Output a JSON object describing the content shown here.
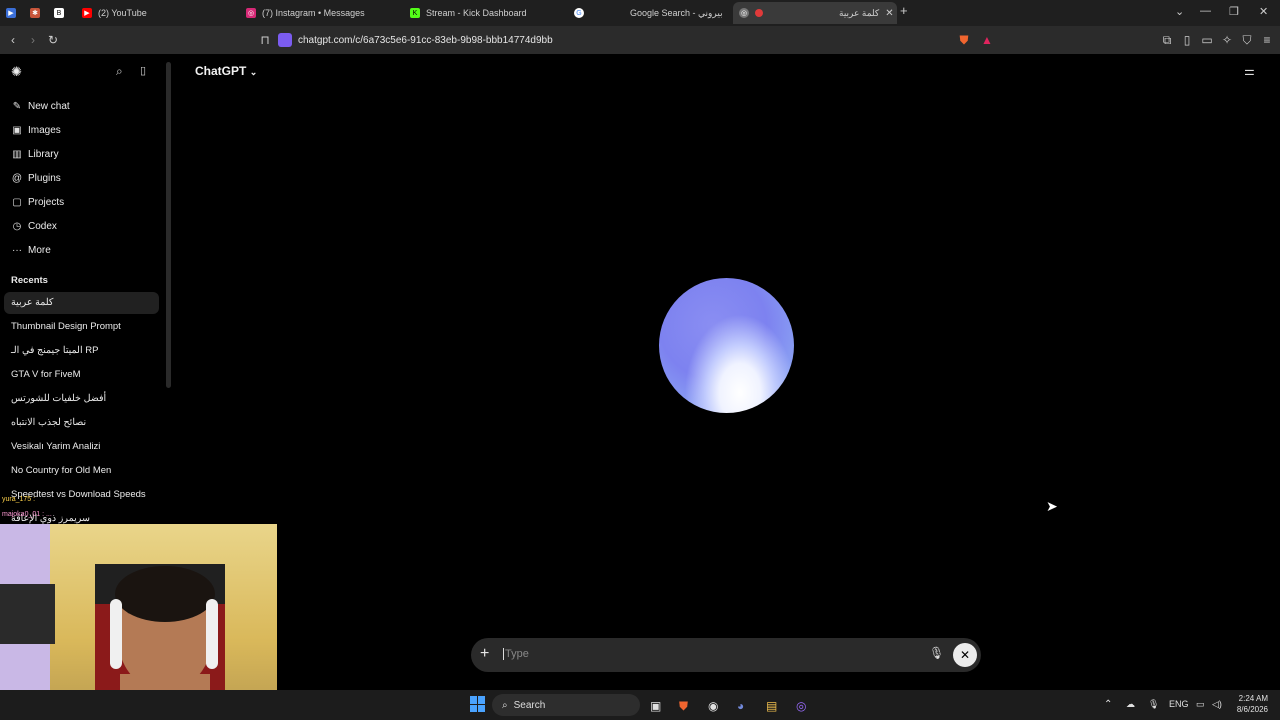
{
  "browser": {
    "tabs": [
      {
        "label": "",
        "icon": "app-icon",
        "color": "#3b6fd8"
      },
      {
        "label": "",
        "icon": "claude-icon",
        "color": "#d86a3b"
      },
      {
        "label": "",
        "icon": "app-icon",
        "color": "#444444"
      },
      {
        "label": "(2) YouTube",
        "icon": "youtube-icon",
        "color": "#ff0000"
      },
      {
        "label": "(7) Instagram • Messages",
        "icon": "instagram-icon",
        "color": "#d62976"
      },
      {
        "label": "Stream - Kick Dashboard",
        "icon": "kick-icon",
        "color": "#53fc18"
      },
      {
        "label": "Google Search - بيتزا بيروني",
        "icon": "google-icon",
        "color": "#4285f4"
      },
      {
        "label": "كلمة عربية",
        "icon": "chatgpt-icon",
        "color": "#888888"
      }
    ],
    "url": "chatgpt.com/c/6a73c5e6-91cc-83eb-9b98-bbb14774d9bb"
  },
  "sidebar": {
    "nav": [
      {
        "label": "New chat",
        "icon": "edit-icon"
      },
      {
        "label": "Images",
        "icon": "image-icon"
      },
      {
        "label": "Library",
        "icon": "library-icon"
      },
      {
        "label": "Plugins",
        "icon": "plugins-icon"
      },
      {
        "label": "Projects",
        "icon": "folder-icon"
      },
      {
        "label": "Codex",
        "icon": "codex-icon"
      },
      {
        "label": "More",
        "icon": "more-icon"
      }
    ],
    "recents_heading": "Recents",
    "recents": [
      "كلمة عربية",
      "Thumbnail Design Prompt",
      "الميتا جيمنج في الـ RP",
      "GTA V for FiveM",
      "أفضل خلفيات للشورتس",
      "نصائح لجذب الانتباه",
      "Vesikalı Yarim Analizi",
      "No Country for Old Men",
      "Speedtest vs Download Speeds",
      "سريمرز ذوي الإعاقة"
    ]
  },
  "main": {
    "model_title": "ChatGPT",
    "input_placeholder": "Type"
  },
  "taskbar": {
    "search_label": "Search",
    "language": "ENG",
    "time": "2:24 AM",
    "date": "8/6/2026"
  },
  "overlay": {
    "chat_lines": [
      "yura_175 :",
      "majoka0_01 : ..."
    ]
  }
}
